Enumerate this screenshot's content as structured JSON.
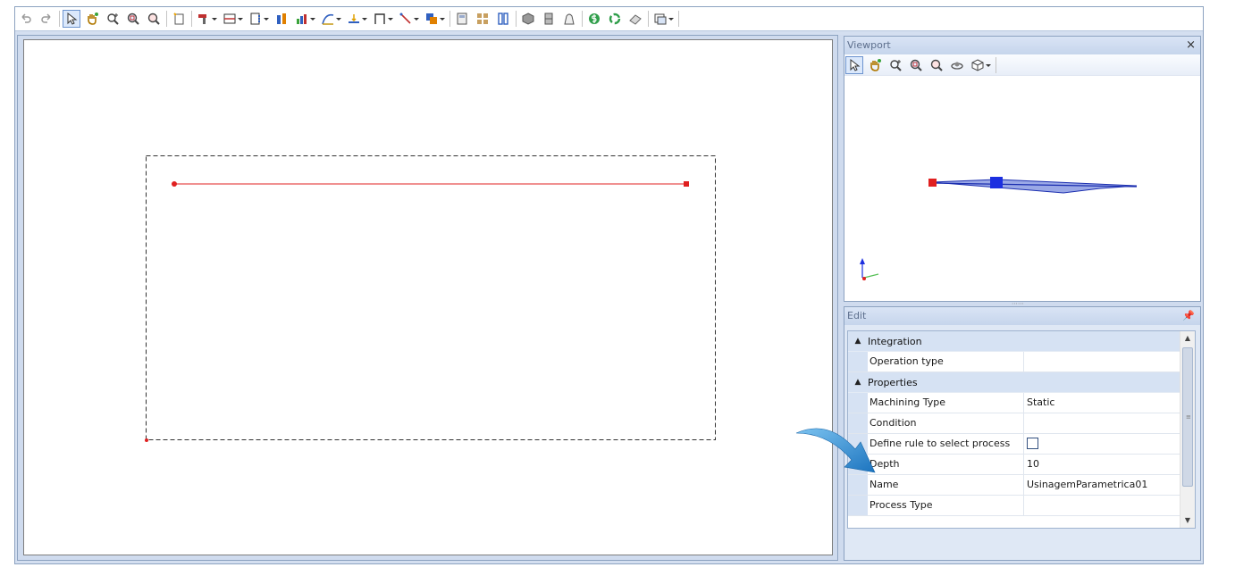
{
  "toolbar": {
    "icons": [
      "undo-icon",
      "redo-icon",
      "select-arrow-icon",
      "pan-hand-icon",
      "zoom-extents-icon",
      "zoom-window-icon",
      "zoom-icon",
      "new-sheet-icon",
      "drill-icon",
      "panel-icon",
      "frame-icon",
      "tool-icon",
      "chart-icon",
      "path-icon",
      "level-icon",
      "bracket-icon",
      "line-icon",
      "copy-icon",
      "calculator-icon",
      "grid-icon",
      "columns-icon",
      "box-icon",
      "cabinet-icon",
      "bag-icon",
      "money-icon",
      "recycle-icon",
      "eraser-icon",
      "window-icon"
    ]
  },
  "viewport": {
    "title": "Viewport",
    "close_label": "×",
    "tools": [
      "select-arrow-icon",
      "pan-hand-icon",
      "zoom-extents-icon",
      "zoom-window-icon",
      "zoom-icon",
      "orbit-icon",
      "cube-view-icon"
    ]
  },
  "edit": {
    "title": "Edit",
    "categories": [
      {
        "title": "Integration",
        "rows": [
          {
            "name": "Operation type",
            "value": ""
          }
        ]
      },
      {
        "title": "Properties",
        "rows": [
          {
            "name": "Machining Type",
            "value": "Static"
          },
          {
            "name": "Condition",
            "value": ""
          },
          {
            "name": "Define rule to select process",
            "value": "",
            "checkbox": true,
            "checked": false
          },
          {
            "name": "Depth",
            "value": "10"
          },
          {
            "name": "Name",
            "value": "UsinagemParametrica01"
          },
          {
            "name": "Process Type",
            "value": ""
          }
        ]
      }
    ]
  },
  "colors": {
    "accent_line": "#e02020",
    "arrow": "#2a8fd6",
    "panel_border": "#8ca2c0"
  }
}
